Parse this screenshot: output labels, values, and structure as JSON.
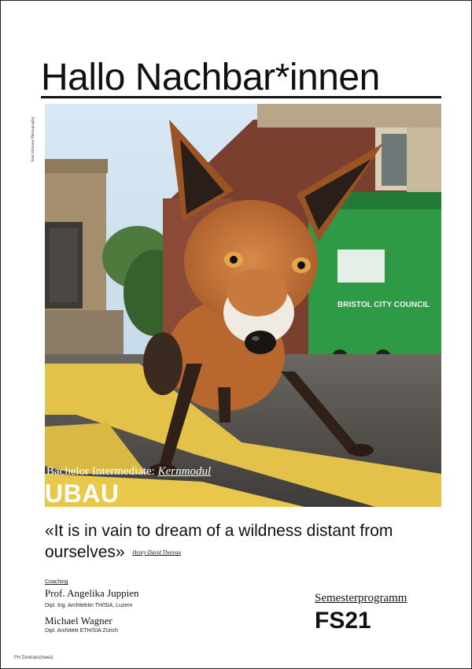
{
  "poster": {
    "title": "Hallo Nachbar*innen",
    "photo_credit": "Sam Hobson Photography",
    "photo_alt": "Red fox standing on a street with a green dumpster",
    "dumpster_text": "BRISTOL CITY COUNCIL",
    "program_prefix": "Bachelor Intermediate:",
    "program_module": "Kernmodul",
    "module_name": "UBAU",
    "quote": "«It is in vain to dream of a wildness distant from ourselves»",
    "quote_author": "Henry David Thoreau",
    "coaching_label": "Coaching",
    "coaches": [
      {
        "name": "Prof. Angelika Juppien",
        "credentials": "Dipl. Ing. Architektin TH/SIA, Luzern"
      },
      {
        "name": "Michael Wagner",
        "credentials": "Dipl. Architekt ETH/SIA Zürich"
      }
    ],
    "semester_label": "Semesterprogramm",
    "semester_code": "FS21",
    "footer": "FH Zentralschweiz"
  },
  "colors": {
    "sky": "#cfe0ee",
    "fox": "#c4733a",
    "dumpster": "#2e9a45",
    "road": "#4a4a4a",
    "road_line": "#e8c74a"
  }
}
